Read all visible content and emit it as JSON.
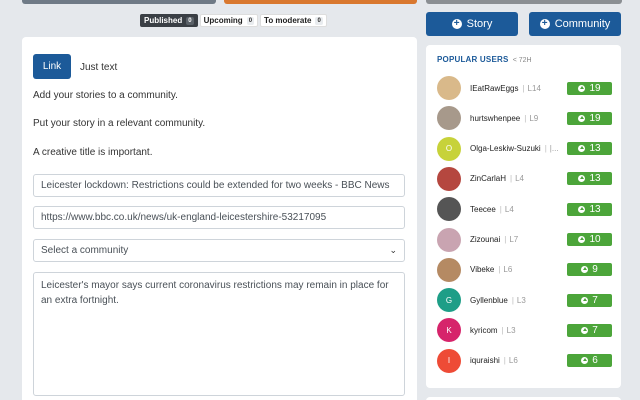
{
  "colors": {
    "accent": "#1c5a99",
    "score": "#4ca53a",
    "background": "#e5e8ec"
  },
  "status_tabs": [
    {
      "label": "Published",
      "count": "0"
    },
    {
      "label": "Upcoming",
      "count": "0"
    },
    {
      "label": "To moderate",
      "count": "0"
    }
  ],
  "buttons": {
    "story": "Story",
    "community": "Community"
  },
  "editor": {
    "tab_link": "Link",
    "tab_text": "Just text",
    "help": [
      "Add your stories to a community.",
      "Put your story in a relevant community.",
      "A creative title is important."
    ],
    "title_value": "Leicester lockdown: Restrictions could be extended for two weeks - BBC News",
    "url_value": "https://www.bbc.co.uk/news/uk-england-leicestershire-53217095",
    "community_select": "Select a community",
    "description_value": "Leicester's mayor says current coronavirus restrictions may remain in place for an extra fortnight."
  },
  "popular_users": {
    "title": "POPULAR USERS",
    "subtitle": "< 72H",
    "users": [
      {
        "name": "IEatRawEggs",
        "level": "L14",
        "score": "19",
        "initial": "",
        "color": "#d9b98a"
      },
      {
        "name": "hurtswhenpee",
        "level": "L9",
        "score": "19",
        "initial": "",
        "color": "#a7998b"
      },
      {
        "name": "Olga-Leskiw-Suzuki",
        "level": "|...",
        "score": "13",
        "initial": "O",
        "color": "#c7d23a"
      },
      {
        "name": "ZinCarlaH",
        "level": "L4",
        "score": "13",
        "initial": "",
        "color": "#b5473f"
      },
      {
        "name": "Teecee",
        "level": "L4",
        "score": "13",
        "initial": "",
        "color": "#555555"
      },
      {
        "name": "Zizounai",
        "level": "L7",
        "score": "10",
        "initial": "",
        "color": "#c9a4b1"
      },
      {
        "name": "Vibeke",
        "level": "L6",
        "score": "9",
        "initial": "",
        "color": "#b58a63"
      },
      {
        "name": "Gyllenblue",
        "level": "L3",
        "score": "7",
        "initial": "G",
        "color": "#1e9e87"
      },
      {
        "name": "kyricom",
        "level": "L3",
        "score": "7",
        "initial": "K",
        "color": "#d6246b"
      },
      {
        "name": "iquraishi",
        "level": "L6",
        "score": "6",
        "initial": "I",
        "color": "#ee4b36"
      }
    ]
  }
}
